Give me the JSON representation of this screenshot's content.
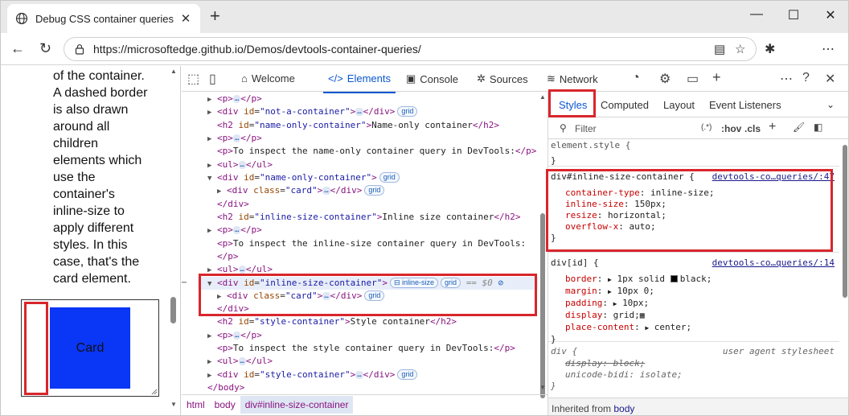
{
  "browser": {
    "tab_title": "Debug CSS container queries",
    "url": "https://microsoftedge.github.io/Demos/devtools-container-queries/"
  },
  "page": {
    "paragraph_lines": [
      "of the container.",
      "A dashed border",
      "is also drawn",
      "around all",
      "children",
      "elements which",
      "use the",
      "container's",
      "inline-size to",
      "apply different",
      "styles. In this",
      "case, that's the",
      "card element."
    ],
    "card_label": "Card"
  },
  "devtools": {
    "tabs": {
      "welcome": "Welcome",
      "elements": "Elements",
      "console": "Console",
      "sources": "Sources",
      "network": "Network"
    },
    "tree": {
      "r1_tag": "<p>",
      "r2_a": "<div ",
      "r2_attr": "id",
      "r2_val": "\"not-a-container\"",
      "r2_b": ">",
      "r2_c": "</div>",
      "r3_a": "<h2 ",
      "r3_attr": "id",
      "r3_val": "\"name-only-container\"",
      "r3_b": ">",
      "r3_text": "Name-only container",
      "r3_c": "</h2>",
      "r4_tag": "<p>",
      "r5_a": "<p>",
      "r5_text": "To inspect the name-only container query in DevTools:",
      "r5_c": "</p>",
      "r6_tag": "<ul>",
      "r6_c": "</ul>",
      "r7_a": "<div ",
      "r7_attr": "id",
      "r7_val": "\"name-only-container\"",
      "r7_b": ">",
      "r8_a": "<div ",
      "r8_attr": "class",
      "r8_val": "\"card\"",
      "r8_b": ">",
      "r8_c": "</div>",
      "r9": "</div>",
      "r10_a": "<h2 ",
      "r10_attr": "id",
      "r10_val": "\"inline-size-container\"",
      "r10_b": ">",
      "r10_text": "Inline size container",
      "r10_c": "</h2>",
      "r11_tag": "<p>",
      "r12_a": "<p>",
      "r12_text": "To inspect the inline-size container query in DevTools:",
      "r13": "</p>",
      "r14_tag": "<ul>",
      "r14_c": "</ul>",
      "r15_a": "<div ",
      "r15_attr": "id",
      "r15_val": "\"inline-size-container\"",
      "r15_b": ">",
      "r15_eq": "== $0",
      "r16_a": "<div ",
      "r16_attr": "class",
      "r16_val": "\"card\"",
      "r16_b": ">",
      "r16_c": "</div>",
      "r17": "</div>",
      "r18_a": "<h2 ",
      "r18_attr": "id",
      "r18_val": "\"style-container\"",
      "r18_b": ">",
      "r18_text": "Style container",
      "r18_c": "</h2>",
      "r19_tag": "<p>",
      "r20_a": "<p>",
      "r20_text": "To inspect the style container query in DevTools:",
      "r20_c": "</p>",
      "r21_tag": "<ul>",
      "r21_c": "</ul>",
      "r22_a": "<div ",
      "r22_attr": "id",
      "r22_val": "\"style-container\"",
      "r22_b": ">",
      "r22_c": "</div>",
      "r23": "</body>",
      "badge_grid": "grid",
      "badge_inline": "inline-size",
      "ellipsis": "…"
    },
    "breadcrumbs": [
      "html",
      "body",
      "div#inline-size-container"
    ],
    "styles": {
      "tabs": {
        "styles": "Styles",
        "computed": "Computed",
        "layout": "Layout",
        "listeners": "Event Listeners"
      },
      "filter_placeholder": "Filter",
      "filter_tools": {
        "pseudo": ":hov",
        "cls": ".cls",
        "star": "(.*)"
      },
      "element_style": "element.style {",
      "close_brace": "}",
      "rule1": {
        "selector": "div#inline-size-container {",
        "source": "devtools-co…queries/:47",
        "decls": [
          {
            "p": "container-type",
            "v": "inline-size;"
          },
          {
            "p": "inline-size",
            "v": "150px;"
          },
          {
            "p": "resize",
            "v": "horizontal;"
          },
          {
            "p": "overflow-x",
            "v": "auto;"
          }
        ]
      },
      "rule2": {
        "selector": "div[id] {",
        "source": "devtools-co…queries/:14",
        "border": "1px solid",
        "border_color": "black;",
        "margin": "10px 0;",
        "padding": "10px;",
        "display": "grid;",
        "place": "center;"
      },
      "rule3": {
        "selector": "div {",
        "source": "user agent stylesheet",
        "d1": "display: block;",
        "d2_p": "unicode-bidi",
        "d2_v": "isolate;"
      },
      "inherited_label": "Inherited from ",
      "inherited_from": "body"
    }
  },
  "colors": {
    "accent": "#0b57d0",
    "highlight": "#d8262c",
    "card": "#0a36f5"
  }
}
